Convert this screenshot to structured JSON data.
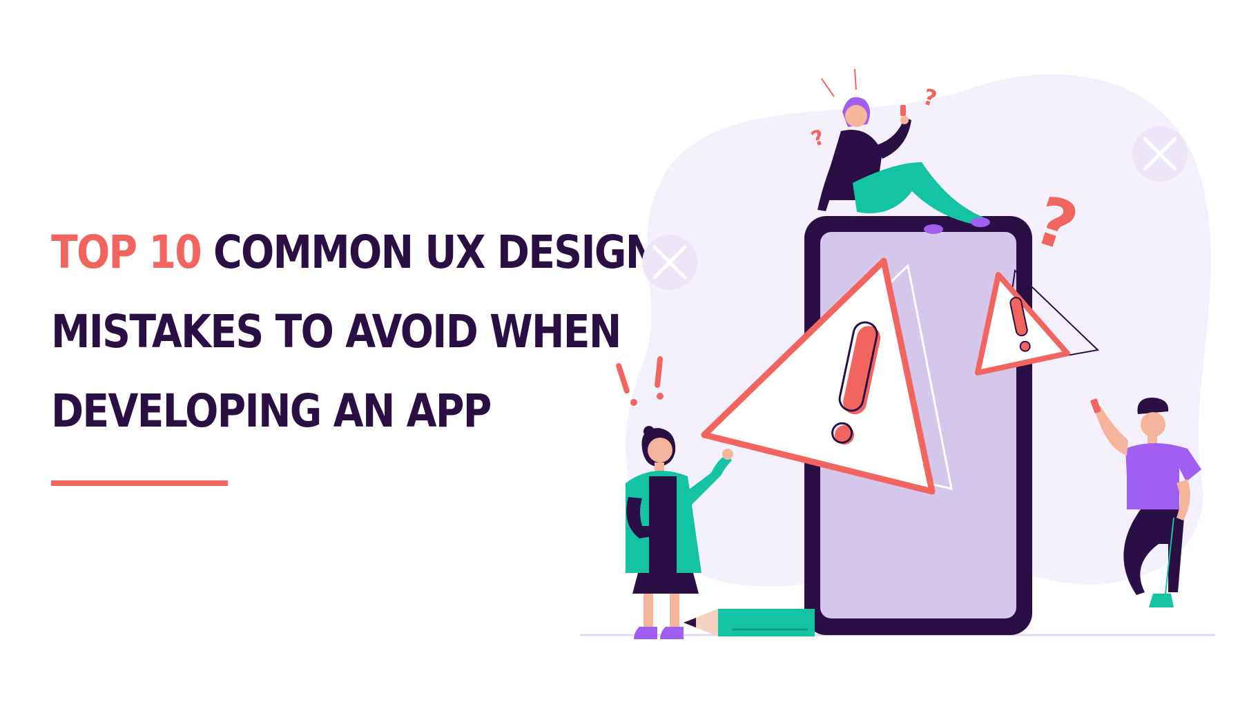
{
  "headline": {
    "accent": "TOP 10",
    "line1_rest": " COMMON UX DESIGN",
    "line2": "MISTAKES TO AVOID WHEN",
    "line3": "DEVELOPING AN APP"
  },
  "colors": {
    "title": "#2a0f45",
    "accent": "#f2645e",
    "blob": "#f5f1fc",
    "phone_screen": "#d5c6ec",
    "phone_frame": "#2a0f45",
    "teal": "#14c3a2",
    "purple": "#a05ff0"
  },
  "icons": [
    "close-icon",
    "warning-icon",
    "question-mark-icon",
    "exclamation-mark-icon"
  ]
}
